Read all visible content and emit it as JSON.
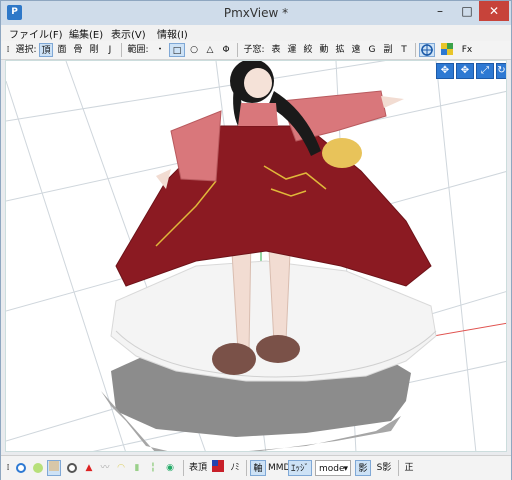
{
  "window": {
    "title": "PmxView *"
  },
  "menu": [
    {
      "label": "ファイル(F)"
    },
    {
      "label": "編集(E)"
    },
    {
      "label": "表示(V)"
    },
    {
      "label": "情報(I)"
    }
  ],
  "toolbar": {
    "select_label": "選択:",
    "select_items": [
      "頂",
      "面",
      "骨",
      "剛",
      "J"
    ],
    "range_label": "範囲:",
    "range_items": [
      "・",
      "□",
      "○",
      "△",
      "Φ"
    ],
    "child_label": "子窓:",
    "child_items": [
      "表",
      "運",
      "絞",
      "動",
      "拡",
      "遠",
      "G",
      "副",
      "T"
    ],
    "fx_label": "Fx"
  },
  "statusbar": {
    "item_surface": "表頂",
    "item_no": "ﾉﾐ",
    "item_axis": "軸",
    "item_mmd": "MMD",
    "item_edge": "ｴｯｼﾞ",
    "mode_value": "mode",
    "item_shadow": "影",
    "item_sshadow": "S影",
    "item_front": "正"
  },
  "colors": {
    "accent": "#2d79d3",
    "close": "#c7433a",
    "dress": "#8b1a22",
    "sleeve": "#d9777b",
    "shadow": "#8c8c8c"
  }
}
